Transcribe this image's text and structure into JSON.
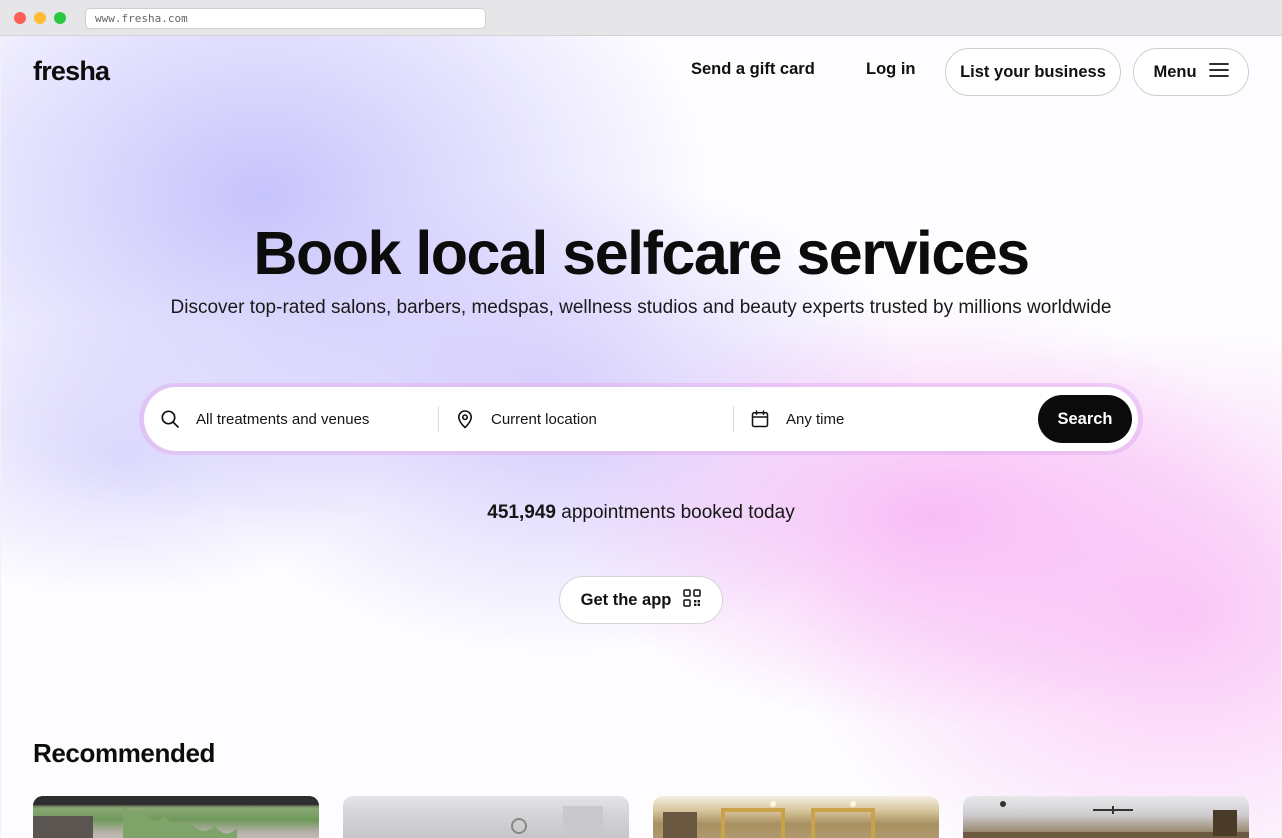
{
  "browser": {
    "url": "www.fresha.com"
  },
  "header": {
    "logo": "fresha",
    "gift_card_label": "Send a gift card",
    "login_label": "Log in",
    "list_business_label": "List your business",
    "menu_label": "Menu"
  },
  "hero": {
    "title": "Book local selfcare services",
    "subtitle": "Discover top-rated salons, barbers, medspas, wellness studios and beauty experts trusted by millions worldwide"
  },
  "search": {
    "treatments_placeholder": "All treatments and venues",
    "location_placeholder": "Current location",
    "time_placeholder": "Any time",
    "button_label": "Search"
  },
  "stats": {
    "count": "451,949",
    "label": " appointments booked today"
  },
  "app": {
    "button_label": "Get the app"
  },
  "recommended": {
    "title": "Recommended"
  },
  "colors": {
    "primary": "#0b0b0b",
    "hero_lavender": "#c4c0fc",
    "hero_pink": "#f8baf6"
  },
  "icons": [
    "search-icon",
    "location-pin-icon",
    "calendar-icon",
    "menu-icon",
    "qr-code-icon"
  ]
}
